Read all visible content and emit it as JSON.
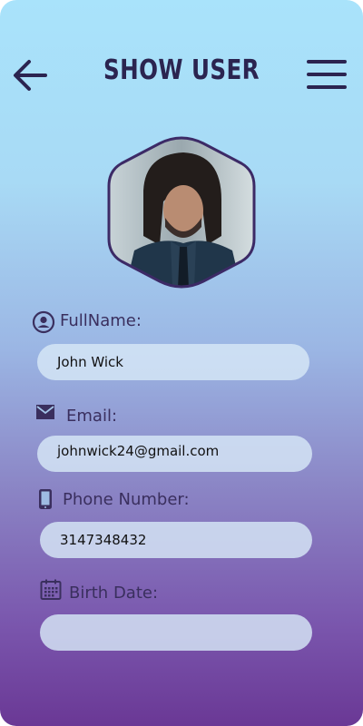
{
  "header": {
    "title": "SHOW USER",
    "back_icon": "arrow-left-icon",
    "menu_icon": "hamburger-menu-icon"
  },
  "profile": {
    "avatar": "user-avatar-photo"
  },
  "fields": {
    "fullname": {
      "label": "FullName:",
      "value": "John  Wick",
      "icon": "user-circle-icon"
    },
    "email": {
      "label": "Email:",
      "value": "johnwick24@gmail.com",
      "icon": "envelope-icon"
    },
    "phone": {
      "label": "Phone Number:",
      "value": "3147348432",
      "icon": "mobile-phone-icon"
    },
    "birth": {
      "label": "Birth Date:",
      "value": "",
      "icon": "calendar-icon"
    }
  },
  "colors": {
    "title": "#2b2450",
    "label": "#3a2f5e",
    "gradient_top": "#a9e3fb",
    "gradient_bottom": "#6a3895",
    "field_bg": "#d7e8f6"
  }
}
